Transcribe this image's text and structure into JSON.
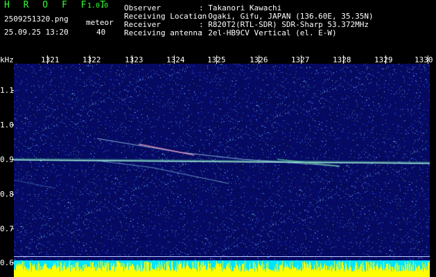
{
  "app": {
    "brand": "H R O F F T",
    "version": "1.0.0",
    "filename": "2509251320.png",
    "datetime": "25.09.25 13:20",
    "meteor_label": "meteor",
    "meteor_count": "40"
  },
  "info": {
    "observer_label": "Observer",
    "observer_value": ": Takanori Kawachi",
    "location_label": "Receiving Location",
    "location_value": ": Ogaki, Gifu, JAPAN (136.60E, 35.35N)",
    "receiver_label": "Receiver",
    "receiver_value": ": R820T2(RTL-SDR) SDR-Sharp 53.372MHz",
    "antenna_label": "Receiving antenna",
    "antenna_value": ": 2el-HB9CV Vertical (el. E-W)"
  },
  "axis": {
    "y_unit": "kHz",
    "x_ticks": [
      "1321",
      "1322",
      "1323",
      "1324",
      "1325",
      "1326",
      "1327",
      "1328",
      "1329",
      "1330"
    ],
    "y_ticks": [
      "1.1",
      "1.0",
      "0.9",
      "0.8",
      "0.7",
      "0.6"
    ]
  },
  "colors": {
    "header_green": "#33ff33",
    "background": "#000000",
    "spectro_base": "#0a0f6e",
    "signal": "#dfffff",
    "bottom_yellow": "#ffff00",
    "bottom_cyan": "#00e5ff"
  }
}
